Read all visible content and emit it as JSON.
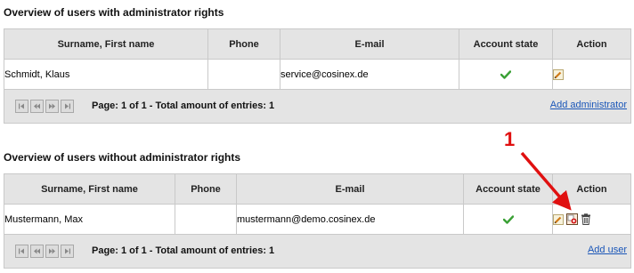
{
  "admin_section": {
    "title": "Overview of users with administrator rights",
    "columns": [
      "Surname, First name",
      "Phone",
      "E-mail",
      "Account state",
      "Action"
    ],
    "rows": [
      {
        "name": "Schmidt, Klaus",
        "phone": "",
        "email": "service@cosinex.de",
        "state_icon": "checkmark-icon",
        "actions": [
          "edit-icon"
        ]
      }
    ],
    "pager_text": "Page: 1 of 1 - Total amount of entries: 1",
    "add_link": "Add administrator"
  },
  "user_section": {
    "title": "Overview of users without administrator rights",
    "columns": [
      "Surname, First name",
      "Phone",
      "E-mail",
      "Account state",
      "Action"
    ],
    "rows": [
      {
        "name": "Mustermann, Max",
        "phone": "",
        "email": "mustermann@demo.cosinex.de",
        "state_icon": "checkmark-icon",
        "actions": [
          "edit-icon",
          "grant-admin-icon",
          "delete-icon"
        ]
      }
    ],
    "pager_text": "Page: 1 of 1 - Total amount of entries: 1",
    "add_link": "Add user"
  },
  "callout": {
    "number": "1",
    "color": "#e01010"
  },
  "colors": {
    "header_bg": "#e4e4e4",
    "link": "#1a56b8",
    "check": "#3aa035",
    "border": "#c9c9c9"
  }
}
